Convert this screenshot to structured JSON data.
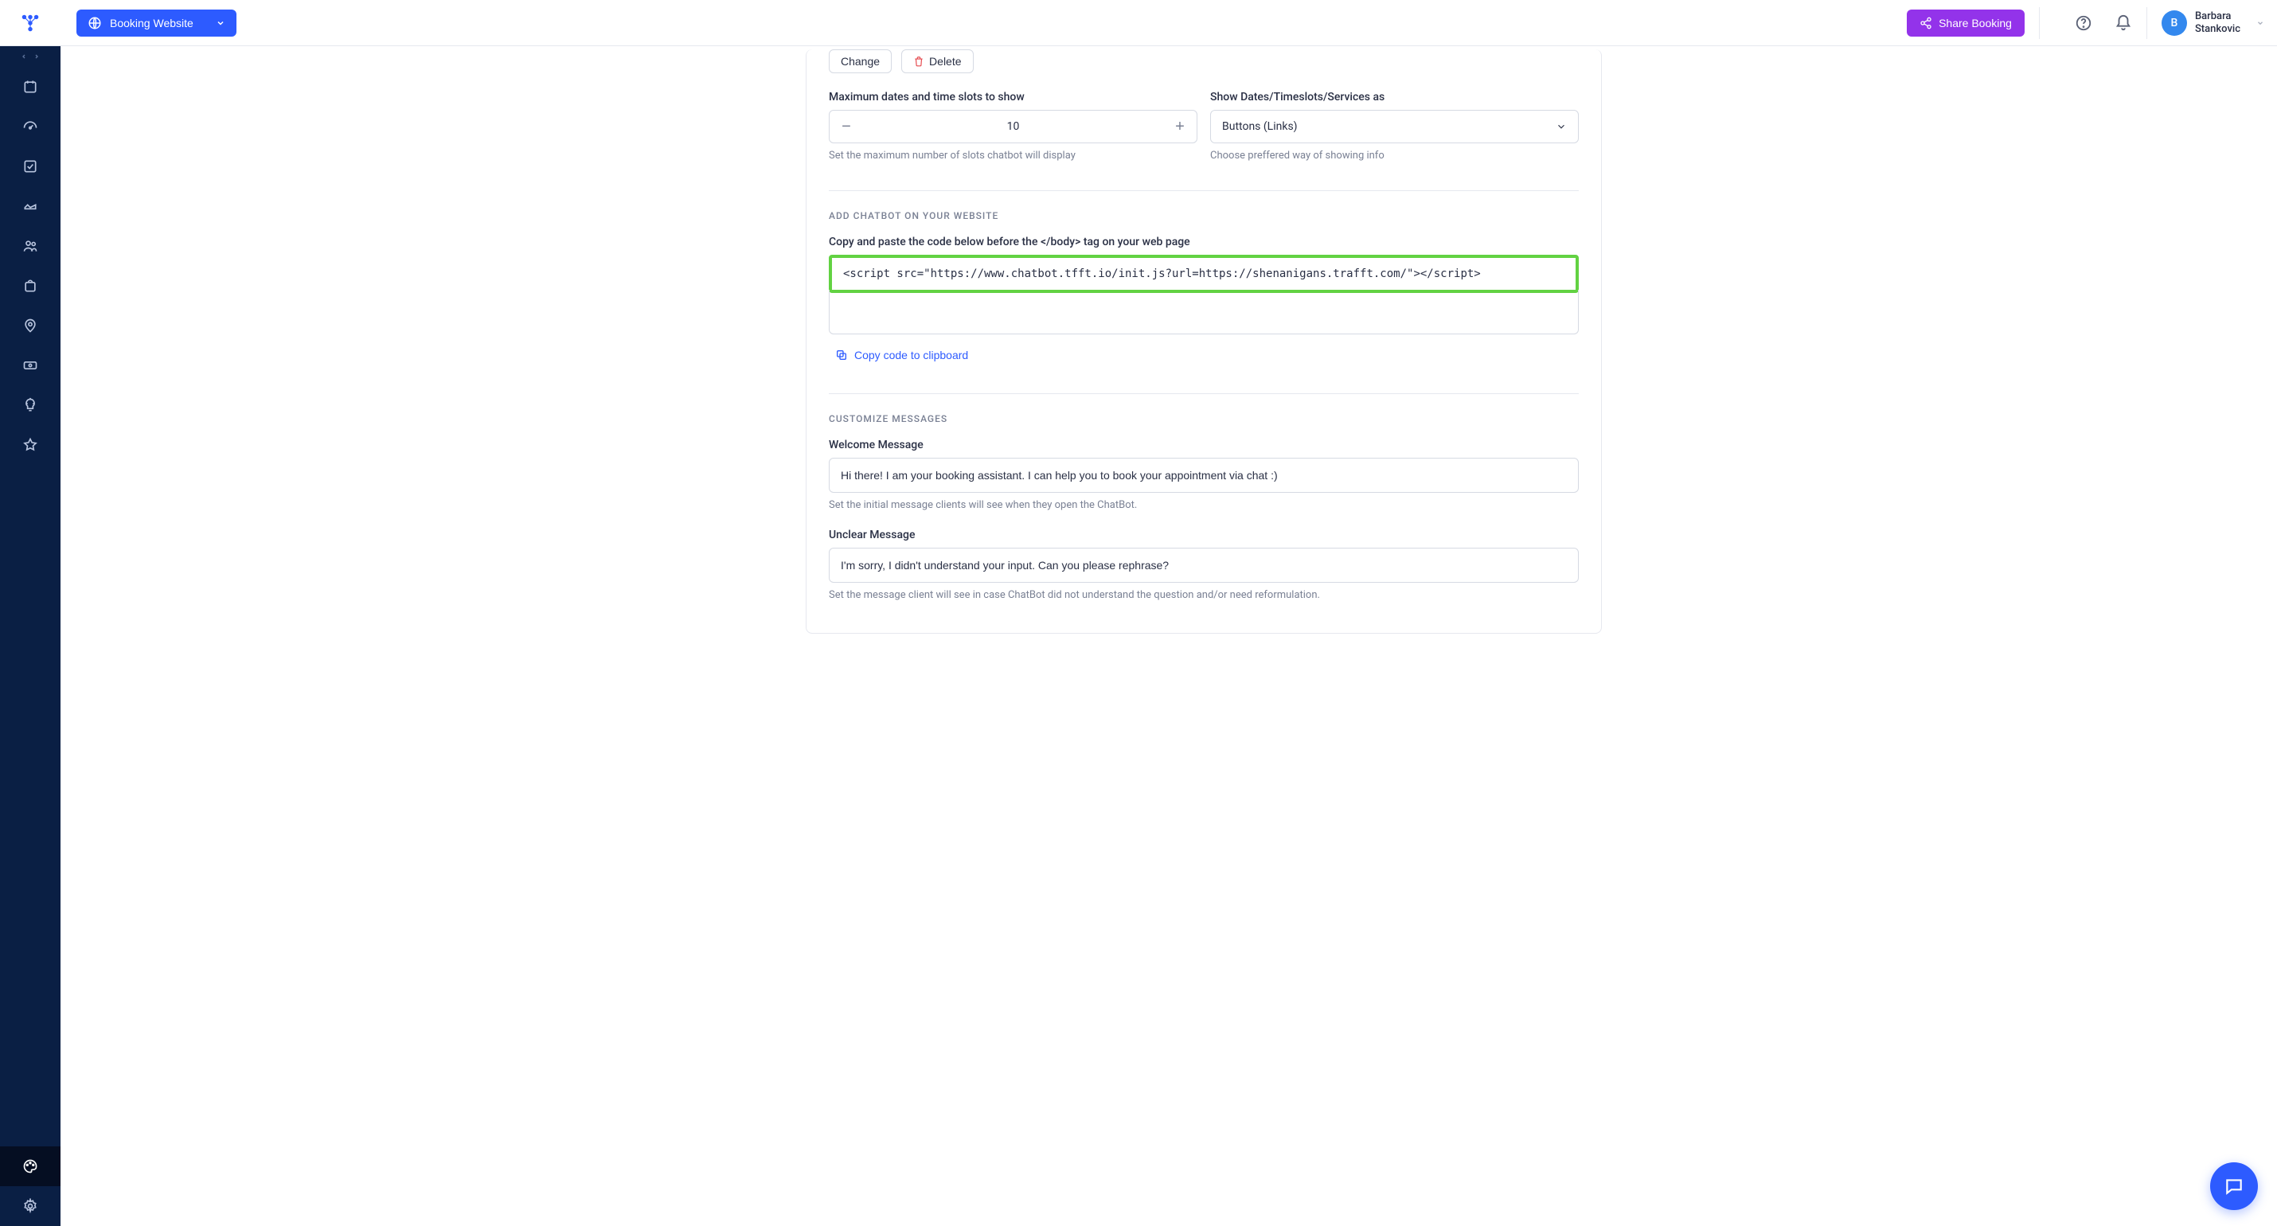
{
  "header": {
    "booking_website_label": "Booking Website",
    "share_label": "Share Booking",
    "user_first": "Barbara",
    "user_last": "Stankovic",
    "avatar_letter": "B"
  },
  "top_actions": {
    "change": "Change",
    "delete": "Delete"
  },
  "slots_section": {
    "max_label": "Maximum dates and time slots to show",
    "max_value": "10",
    "max_hint": "Set the maximum number of slots chatbot will display",
    "show_as_label": "Show Dates/Timeslots/Services as",
    "show_as_value": "Buttons (Links)",
    "show_as_hint": "Choose preffered way of showing info"
  },
  "embed_section": {
    "title": "ADD CHATBOT ON YOUR WEBSITE",
    "instruction": "Copy and paste the code below before the </body> tag on your web page",
    "code": "<script src=\"https://www.chatbot.tfft.io/init.js?url=https://shenanigans.trafft.com/\"></script>",
    "copy_label": "Copy code to clipboard"
  },
  "messages_section": {
    "title": "CUSTOMIZE MESSAGES",
    "welcome_label": "Welcome Message",
    "welcome_value": "Hi there! I am your booking assistant. I can help you to book your appointment via chat :)",
    "welcome_hint": "Set the initial message clients will see when they open the ChatBot.",
    "unclear_label": "Unclear Message",
    "unclear_value": "I'm sorry, I didn't understand your input. Can you please rephrase?",
    "unclear_hint": "Set the message client will see in case ChatBot did not understand the question and/or need reformulation."
  }
}
